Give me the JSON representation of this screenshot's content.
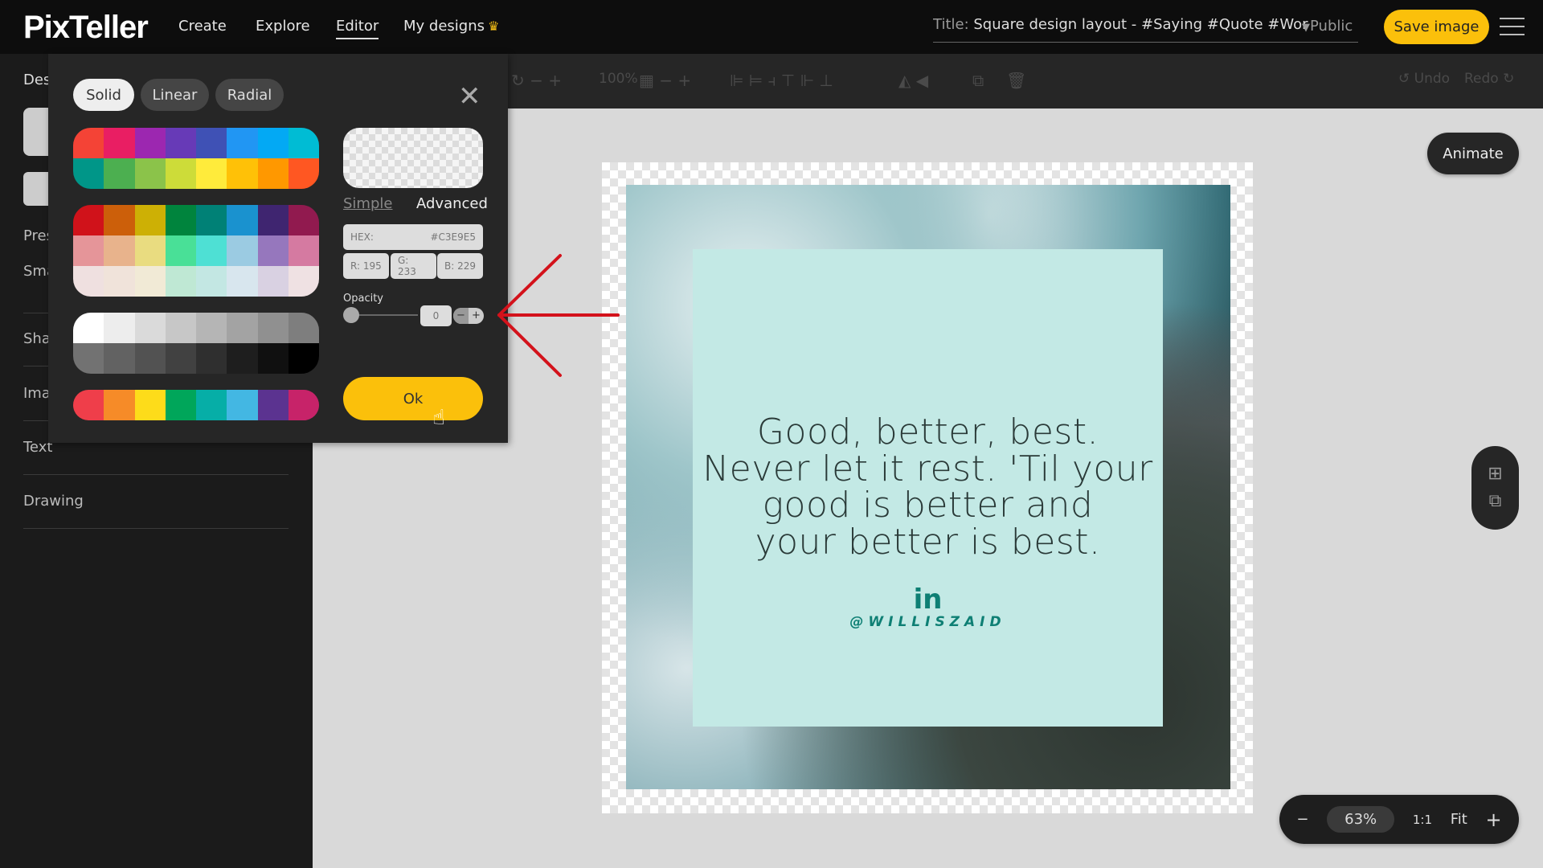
{
  "header": {
    "logo": "PixTeller",
    "nav": [
      {
        "label": "Create"
      },
      {
        "label": "Explore"
      },
      {
        "label": "Editor",
        "active": true
      },
      {
        "label": "My designs"
      }
    ],
    "title_label": "Title:",
    "title_value": "Square design layout - #Saying #Quote #Wor",
    "visibility": "Public",
    "save_label": "Save image"
  },
  "toolbar": {
    "zoom": "100%",
    "undo": "Undo",
    "redo": "Redo"
  },
  "sidebar": {
    "items": [
      {
        "label": "Des"
      },
      {
        "label": "Pres"
      },
      {
        "label": "Sma"
      },
      {
        "label": "Sha"
      },
      {
        "label": "Ima"
      },
      {
        "label": "Text"
      },
      {
        "label": "Drawing"
      }
    ]
  },
  "color_picker": {
    "tabs": [
      {
        "label": "Solid",
        "selected": true
      },
      {
        "label": "Linear"
      },
      {
        "label": "Radial"
      }
    ],
    "swatch_groups": [
      [
        "#f44336",
        "#e91e63",
        "#9c27b0",
        "#673ab7",
        "#3f51b5",
        "#2196f3",
        "#03a9f4",
        "#00bcd4",
        "#009688",
        "#4caf50",
        "#8bc34a",
        "#cddc39",
        "#ffeb3b",
        "#ffc107",
        "#ff9800",
        "#ff5722"
      ],
      [
        "#d0121a",
        "#cc5f0a",
        "#cdb005",
        "#00843d",
        "#008176",
        "#1a92cf",
        "#3f2570",
        "#911a4f",
        "#e59599",
        "#e8b38c",
        "#e9dc80",
        "#49e097",
        "#4ee0d4",
        "#9bcbe2",
        "#9677bd",
        "#d57aa1",
        "#efe0e0",
        "#f0e3da",
        "#f1ead6",
        "#bfe8d4",
        "#c3e7e3",
        "#d8e6ee",
        "#d9d1e2",
        "#efe1e3"
      ],
      [
        "#ffffff",
        "#ededed",
        "#dadada",
        "#c7c7c7",
        "#b5b5b5",
        "#a3a3a3",
        "#909090",
        "#7e7e7e",
        "#727272",
        "#626262",
        "#525252",
        "#414141",
        "#2f2f2f",
        "#1e1e1e",
        "#101010",
        "#000000"
      ],
      [
        "#ef3e4a",
        "#f68b28",
        "#fddc1a",
        "#00a65a",
        "#06aea7",
        "#43b7e3",
        "#5b3390",
        "#c72369"
      ]
    ],
    "mode_simple": "Simple",
    "mode_advanced": "Advanced",
    "hex_label": "HEX:",
    "hex_value": "#C3E9E5",
    "r": "R: 195",
    "g": "G: 233",
    "b": "B: 229",
    "opacity_label": "Opacity",
    "opacity_value": "0",
    "ok_label": "Ok"
  },
  "canvas": {
    "quote_lines": [
      "Good, better, best.",
      "Never let it rest. 'Til your",
      "good is better and",
      "your better is best."
    ],
    "social_icon": "in",
    "handle": "@WILLISZAID",
    "box_color": "#C3E9E5",
    "animate_label": "Animate"
  },
  "zoombar": {
    "minus": "−",
    "value": "63%",
    "one_to_one": "1:1",
    "fit": "Fit",
    "plus": "+"
  },
  "colors": {
    "accent": "#fbc00b",
    "annotation_arrow": "#d3121b"
  }
}
